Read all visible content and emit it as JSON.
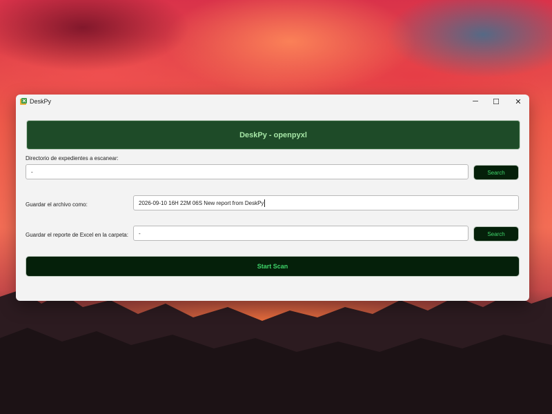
{
  "window": {
    "title": "DeskPy",
    "controls": {
      "minimize": "─",
      "maximize": "☐",
      "close": "✕"
    }
  },
  "banner": {
    "text": "DeskPy - openpyxl"
  },
  "directory": {
    "label": "Directorio de expedientes a escanear:",
    "value": "-",
    "button": "Search"
  },
  "save_as": {
    "label": "Guardar el archivo como:",
    "value": "2026-09-10 16H 22M 06S New report from DeskPy"
  },
  "excel_folder": {
    "label": "Guardar el reporte de Excel en la carpeta:",
    "value": "-",
    "button": "Search"
  },
  "start_button": "Start Scan",
  "colors": {
    "banner_bg": "#1e4b28",
    "banner_text": "#a6e6a6",
    "button_bg": "#05200a",
    "button_text": "#3fd46a"
  },
  "icons": {
    "app": "spreadsheet-app-icon"
  }
}
